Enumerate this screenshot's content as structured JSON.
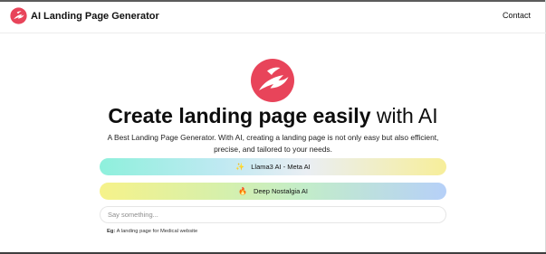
{
  "header": {
    "brand_name": "AI Landing Page Generator",
    "brand_icon": "phoenix-logo-icon",
    "contact_label": "Contact"
  },
  "hero": {
    "logo_icon": "phoenix-logo-icon",
    "headline_strong": "Create landing page easily",
    "headline_light": "with AI",
    "subtitle": "A Best Landing Page Generator. With AI, creating a landing page is not only easy but also efficient, precise, and tailored to your needs."
  },
  "models": [
    {
      "emoji": "✨",
      "label": "Llama3 AI - Meta AI"
    },
    {
      "emoji": "🔥",
      "label": "Deep Nostalgia AI"
    }
  ],
  "prompt": {
    "placeholder": "Say something...",
    "value": "",
    "hint_label": "Eg:",
    "hint_text": " A landing page for Medical website"
  },
  "colors": {
    "brand": "#e8445a",
    "text": "#111111"
  }
}
